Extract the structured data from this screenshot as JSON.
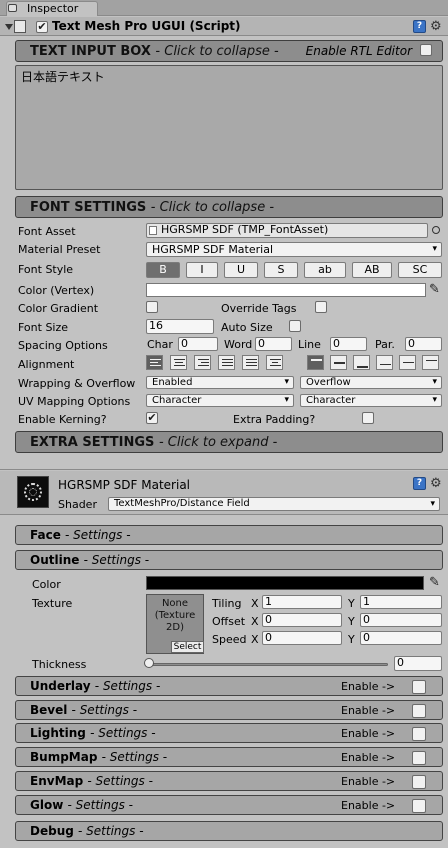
{
  "inspector_tab": {
    "label": "Inspector"
  },
  "component": {
    "title": "Text Mesh Pro UGUI (Script)",
    "enabled_check": "✔"
  },
  "text_input": {
    "header": "TEXT INPUT BOX",
    "collapse": "- Click to collapse -",
    "rtl_label": "Enable RTL Editor",
    "text": "日本語テキスト"
  },
  "font_settings": {
    "header": "FONT SETTINGS",
    "collapse": "- Click to collapse -",
    "font_asset_label": "Font Asset",
    "font_asset_value": "HGRSMP SDF (TMP_FontAsset)",
    "material_preset_label": "Material Preset",
    "material_preset_value": "HGRSMP SDF Material",
    "font_style_label": "Font Style",
    "font_style_buttons": [
      "B",
      "I",
      "U",
      "S",
      "ab",
      "AB",
      "SC"
    ],
    "color_label": "Color (Vertex)",
    "gradient_label": "Color Gradient",
    "override_tags_label": "Override Tags",
    "font_size_label": "Font Size",
    "font_size_value": "16",
    "auto_size_label": "Auto Size",
    "spacing_label": "Spacing Options",
    "spacing_char_label": "Char",
    "spacing_char_value": "0",
    "spacing_word_label": "Word",
    "spacing_word_value": "0",
    "spacing_line_label": "Line",
    "spacing_line_value": "0",
    "spacing_par_label": "Par.",
    "spacing_par_value": "0",
    "alignment_label": "Alignment",
    "wrapping_label": "Wrapping & Overflow",
    "wrapping_value": "Enabled",
    "overflow_value": "Overflow",
    "uv_label": "UV Mapping Options",
    "uv_h_value": "Character",
    "uv_v_value": "Character",
    "kerning_label": "Enable Kerning?",
    "kerning_check": "✔",
    "extra_padding_label": "Extra Padding?"
  },
  "extra_settings": {
    "header": "EXTRA SETTINGS",
    "expand": "- Click to expand -"
  },
  "material": {
    "name": "HGRSMP SDF Material",
    "shader_label": "Shader",
    "shader_value": "TextMeshPro/Distance Field"
  },
  "face": {
    "title": "Face",
    "sub": "- Settings -"
  },
  "outline": {
    "title": "Outline",
    "sub": "- Settings -",
    "color_label": "Color",
    "texture_label": "Texture",
    "texture_slot_text": "None\n(Texture\n2D)",
    "select_label": "Select",
    "tiling_label": "Tiling",
    "offset_label": "Offset",
    "speed_label": "Speed",
    "x_label": "X",
    "y_label": "Y",
    "tiling_x": "1",
    "tiling_y": "1",
    "offset_x": "0",
    "offset_y": "0",
    "speed_x": "0",
    "speed_y": "0",
    "thickness_label": "Thickness",
    "thickness_value": "0"
  },
  "sections": [
    {
      "title": "Underlay",
      "sub": "- Settings -",
      "enable": "Enable ->"
    },
    {
      "title": "Bevel",
      "sub": "- Settings -",
      "enable": "Enable ->"
    },
    {
      "title": "Lighting",
      "sub": "- Settings -",
      "enable": "Enable ->"
    },
    {
      "title": "BumpMap",
      "sub": "- Settings -",
      "enable": "Enable ->"
    },
    {
      "title": "EnvMap",
      "sub": "- Settings -",
      "enable": "Enable ->"
    },
    {
      "title": "Glow",
      "sub": "- Settings -",
      "enable": "Enable ->"
    },
    {
      "title": "Debug",
      "sub": "- Settings -",
      "enable": ""
    }
  ],
  "colors": {
    "section_bg": "#8d8d8d",
    "panel_bg": "#c2c2c2",
    "outline_color": "#000000",
    "vertex_color": "#ffffff"
  }
}
